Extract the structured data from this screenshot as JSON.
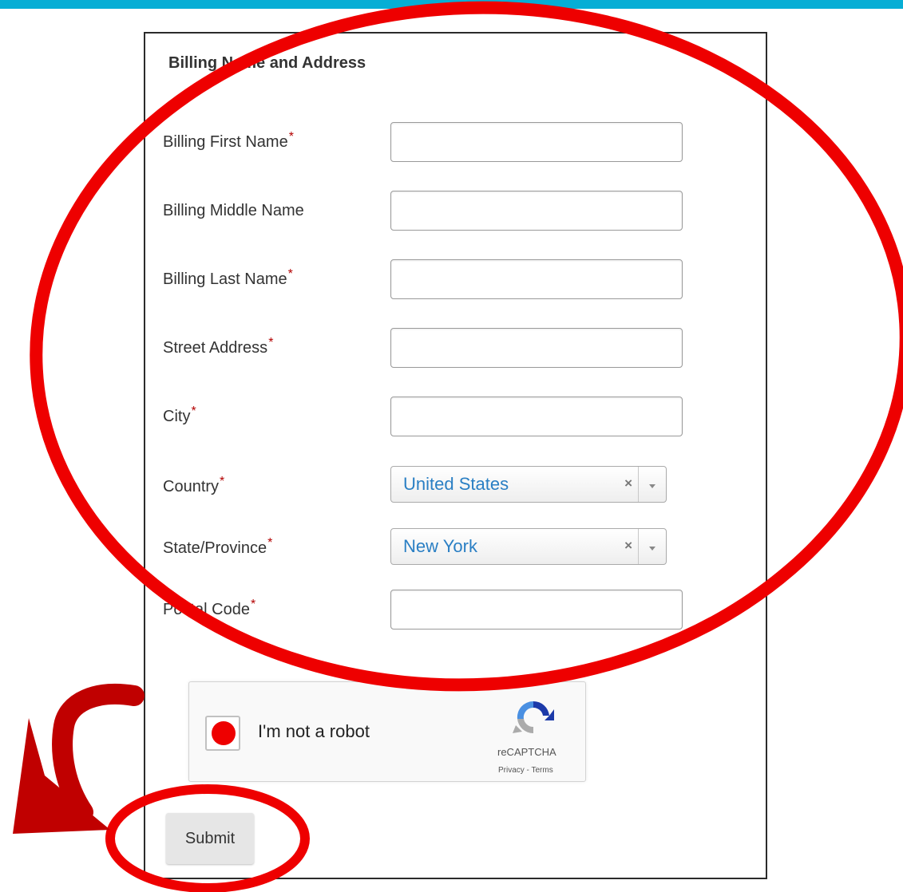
{
  "form": {
    "section_title": "Billing Name and Address",
    "required_marker": "*",
    "fields": {
      "first_name": {
        "label": "Billing First Name",
        "required": true,
        "value": ""
      },
      "middle_name": {
        "label": "Billing Middle Name",
        "required": false,
        "value": ""
      },
      "last_name": {
        "label": "Billing Last Name",
        "required": true,
        "value": ""
      },
      "street": {
        "label": "Street Address",
        "required": true,
        "value": ""
      },
      "city": {
        "label": "City",
        "required": true,
        "value": ""
      },
      "country": {
        "label": "Country",
        "required": true,
        "selected": "United States",
        "clear": "×"
      },
      "state": {
        "label": "State/Province",
        "required": true,
        "selected": "New York",
        "clear": "×"
      },
      "postal": {
        "label": "Postal Code",
        "required": true,
        "value": ""
      }
    }
  },
  "captcha": {
    "label": "I'm not a robot",
    "brand": "reCAPTCHA",
    "links": "Privacy - Terms"
  },
  "submit_label": "Submit",
  "colors": {
    "top_bar": "#06aed5",
    "annotation": "#ee0000",
    "select_value": "#2a7fc4",
    "required_marker": "#b30000"
  },
  "icons": {
    "captcha_logo": "recaptcha-icon",
    "select_arrow": "chevron-down-icon",
    "select_clear": "close-icon"
  }
}
